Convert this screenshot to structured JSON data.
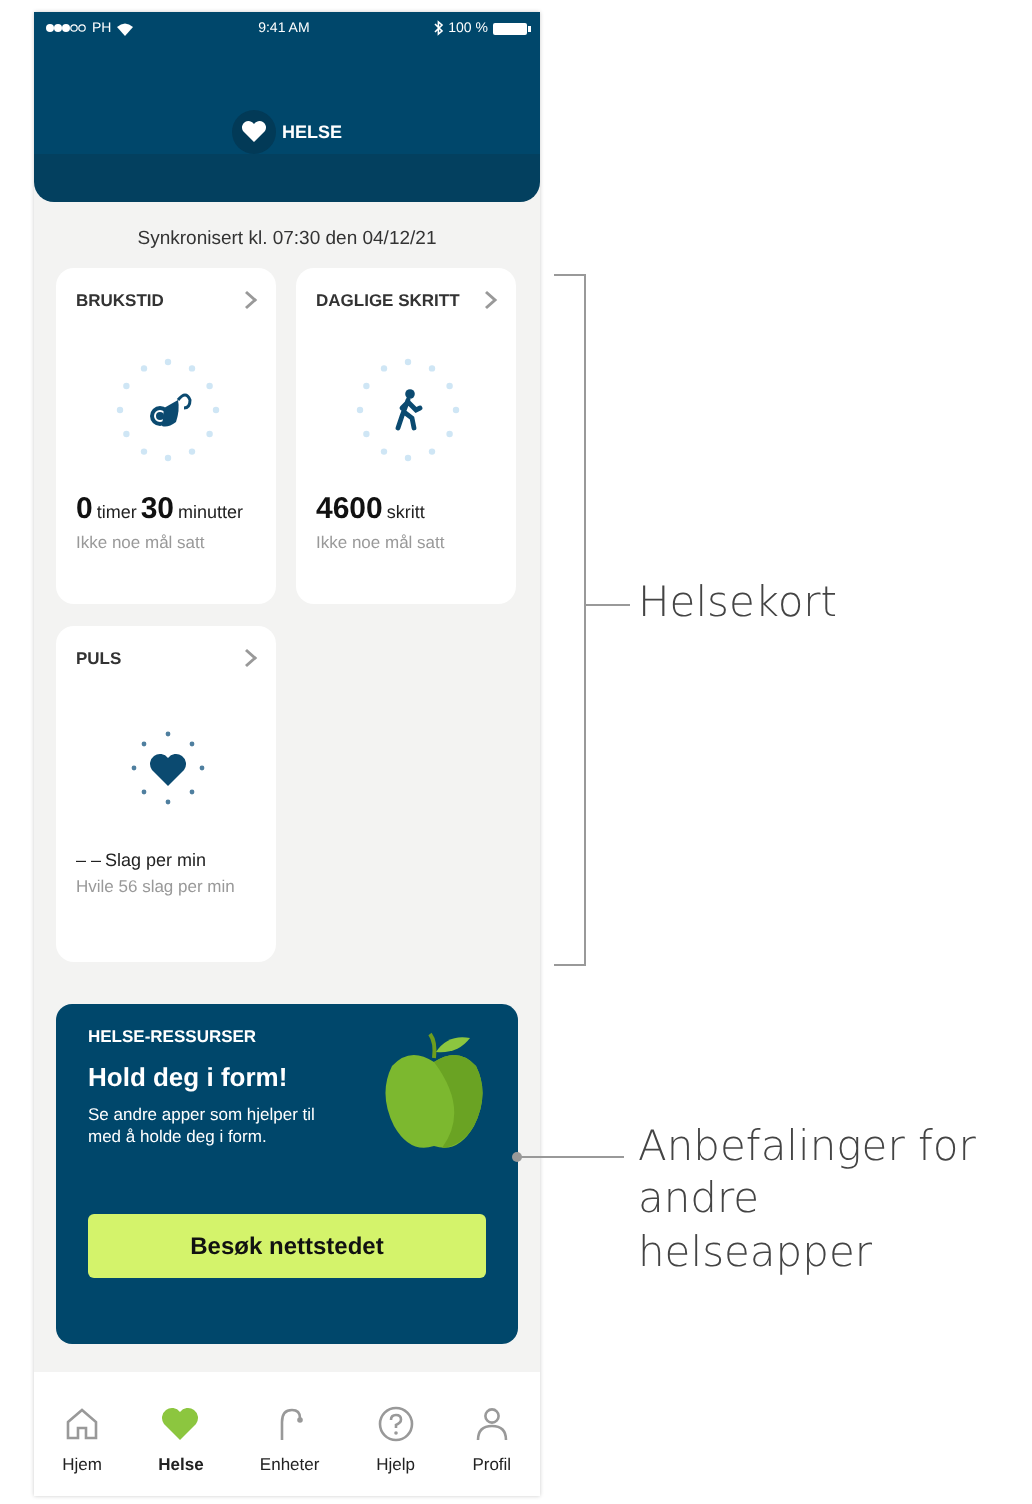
{
  "status_bar": {
    "carrier": "PH",
    "time": "9:41 AM",
    "battery": "100 %"
  },
  "header": {
    "title": "HELSE"
  },
  "sync_text": "Synkronisert kl. 07:30 den 04/12/21",
  "cards": [
    {
      "kind": "usage",
      "title": "BRUKSTID",
      "reading": [
        {
          "text": "0",
          "big": true
        },
        {
          "text": "timer",
          "big": false
        },
        {
          "text": "30",
          "big": true
        },
        {
          "text": "minutter",
          "big": false
        }
      ],
      "note": "Ikke noe mål satt"
    },
    {
      "kind": "steps",
      "title": "DAGLIGE SKRITT",
      "reading": [
        {
          "text": "4600",
          "big": true
        },
        {
          "text": "skritt",
          "big": false
        }
      ],
      "note": "Ikke noe mål satt"
    },
    {
      "kind": "pulse",
      "title": "PULS",
      "reading": [
        {
          "text": "– –",
          "big": false
        },
        {
          "text": "Slag per min",
          "big": false
        }
      ],
      "note": "Hvile 56 slag per min"
    }
  ],
  "resources": {
    "label": "HELSE-RESSURSER",
    "title": "Hold deg i form!",
    "text": "Se andre apper som hjelper til med å holde deg i form.",
    "button": "Besøk nettstedet"
  },
  "tab_bar": [
    {
      "kind": "home",
      "label": "Hjem",
      "selected": false
    },
    {
      "kind": "health",
      "label": "Helse",
      "selected": true
    },
    {
      "kind": "devices",
      "label": "Enheter",
      "selected": false
    },
    {
      "kind": "help",
      "label": "Hjelp",
      "selected": false
    },
    {
      "kind": "profile",
      "label": "Profil",
      "selected": false
    }
  ],
  "callouts": [
    {
      "kind": "bracket",
      "label": "Helsekort"
    },
    {
      "kind": "leader",
      "label": "Anbefalinger for andre helseapper"
    }
  ]
}
